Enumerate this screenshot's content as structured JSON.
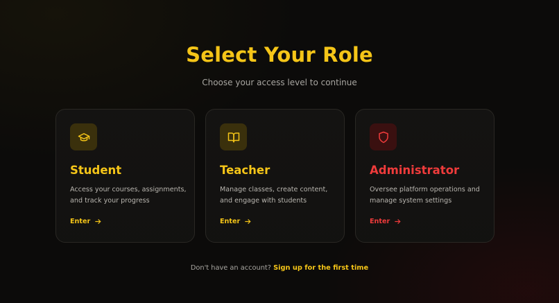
{
  "page": {
    "title": "Select Your Role",
    "subtitle": "Choose your access level to continue"
  },
  "roles": [
    {
      "title": "Student",
      "description": "Access your courses, assignments, and track your progress",
      "action": "Enter",
      "icon": "graduation-cap-icon",
      "accent": "#f5c518"
    },
    {
      "title": "Teacher",
      "description": "Manage classes, create content, and engage with students",
      "action": "Enter",
      "icon": "book-open-icon",
      "accent": "#f5c518"
    },
    {
      "title": "Administrator",
      "description": "Oversee platform operations and manage system settings",
      "action": "Enter",
      "icon": "shield-icon",
      "accent": "#ef3b3b"
    }
  ],
  "footer": {
    "prompt": "Don't have an account?",
    "link": "Sign up for the first time"
  },
  "colors": {
    "accent_gold": "#f5c518",
    "accent_red": "#ef3b3b",
    "background": "#0c0b0a"
  }
}
